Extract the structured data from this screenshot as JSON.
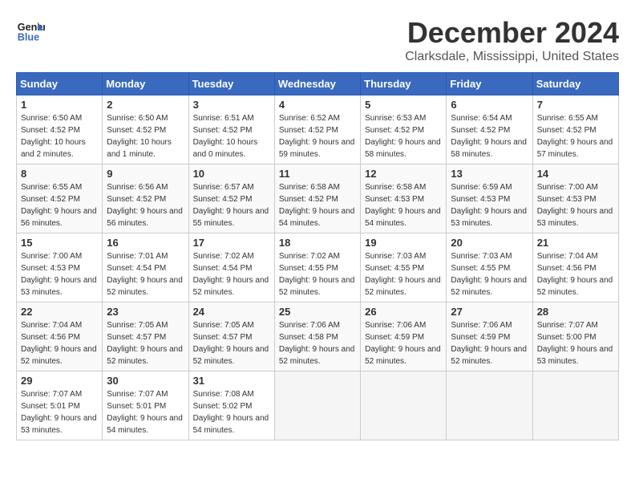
{
  "header": {
    "logo_line1": "General",
    "logo_line2": "Blue",
    "month_year": "December 2024",
    "location": "Clarksdale, Mississippi, United States"
  },
  "weekdays": [
    "Sunday",
    "Monday",
    "Tuesday",
    "Wednesday",
    "Thursday",
    "Friday",
    "Saturday"
  ],
  "weeks": [
    [
      {
        "day": "1",
        "sunrise": "6:50 AM",
        "sunset": "4:52 PM",
        "daylight": "10 hours and 2 minutes."
      },
      {
        "day": "2",
        "sunrise": "6:50 AM",
        "sunset": "4:52 PM",
        "daylight": "10 hours and 1 minute."
      },
      {
        "day": "3",
        "sunrise": "6:51 AM",
        "sunset": "4:52 PM",
        "daylight": "10 hours and 0 minutes."
      },
      {
        "day": "4",
        "sunrise": "6:52 AM",
        "sunset": "4:52 PM",
        "daylight": "9 hours and 59 minutes."
      },
      {
        "day": "5",
        "sunrise": "6:53 AM",
        "sunset": "4:52 PM",
        "daylight": "9 hours and 58 minutes."
      },
      {
        "day": "6",
        "sunrise": "6:54 AM",
        "sunset": "4:52 PM",
        "daylight": "9 hours and 58 minutes."
      },
      {
        "day": "7",
        "sunrise": "6:55 AM",
        "sunset": "4:52 PM",
        "daylight": "9 hours and 57 minutes."
      }
    ],
    [
      {
        "day": "8",
        "sunrise": "6:55 AM",
        "sunset": "4:52 PM",
        "daylight": "9 hours and 56 minutes."
      },
      {
        "day": "9",
        "sunrise": "6:56 AM",
        "sunset": "4:52 PM",
        "daylight": "9 hours and 56 minutes."
      },
      {
        "day": "10",
        "sunrise": "6:57 AM",
        "sunset": "4:52 PM",
        "daylight": "9 hours and 55 minutes."
      },
      {
        "day": "11",
        "sunrise": "6:58 AM",
        "sunset": "4:52 PM",
        "daylight": "9 hours and 54 minutes."
      },
      {
        "day": "12",
        "sunrise": "6:58 AM",
        "sunset": "4:53 PM",
        "daylight": "9 hours and 54 minutes."
      },
      {
        "day": "13",
        "sunrise": "6:59 AM",
        "sunset": "4:53 PM",
        "daylight": "9 hours and 53 minutes."
      },
      {
        "day": "14",
        "sunrise": "7:00 AM",
        "sunset": "4:53 PM",
        "daylight": "9 hours and 53 minutes."
      }
    ],
    [
      {
        "day": "15",
        "sunrise": "7:00 AM",
        "sunset": "4:53 PM",
        "daylight": "9 hours and 53 minutes."
      },
      {
        "day": "16",
        "sunrise": "7:01 AM",
        "sunset": "4:54 PM",
        "daylight": "9 hours and 52 minutes."
      },
      {
        "day": "17",
        "sunrise": "7:02 AM",
        "sunset": "4:54 PM",
        "daylight": "9 hours and 52 minutes."
      },
      {
        "day": "18",
        "sunrise": "7:02 AM",
        "sunset": "4:55 PM",
        "daylight": "9 hours and 52 minutes."
      },
      {
        "day": "19",
        "sunrise": "7:03 AM",
        "sunset": "4:55 PM",
        "daylight": "9 hours and 52 minutes."
      },
      {
        "day": "20",
        "sunrise": "7:03 AM",
        "sunset": "4:55 PM",
        "daylight": "9 hours and 52 minutes."
      },
      {
        "day": "21",
        "sunrise": "7:04 AM",
        "sunset": "4:56 PM",
        "daylight": "9 hours and 52 minutes."
      }
    ],
    [
      {
        "day": "22",
        "sunrise": "7:04 AM",
        "sunset": "4:56 PM",
        "daylight": "9 hours and 52 minutes."
      },
      {
        "day": "23",
        "sunrise": "7:05 AM",
        "sunset": "4:57 PM",
        "daylight": "9 hours and 52 minutes."
      },
      {
        "day": "24",
        "sunrise": "7:05 AM",
        "sunset": "4:57 PM",
        "daylight": "9 hours and 52 minutes."
      },
      {
        "day": "25",
        "sunrise": "7:06 AM",
        "sunset": "4:58 PM",
        "daylight": "9 hours and 52 minutes."
      },
      {
        "day": "26",
        "sunrise": "7:06 AM",
        "sunset": "4:59 PM",
        "daylight": "9 hours and 52 minutes."
      },
      {
        "day": "27",
        "sunrise": "7:06 AM",
        "sunset": "4:59 PM",
        "daylight": "9 hours and 52 minutes."
      },
      {
        "day": "28",
        "sunrise": "7:07 AM",
        "sunset": "5:00 PM",
        "daylight": "9 hours and 53 minutes."
      }
    ],
    [
      {
        "day": "29",
        "sunrise": "7:07 AM",
        "sunset": "5:01 PM",
        "daylight": "9 hours and 53 minutes."
      },
      {
        "day": "30",
        "sunrise": "7:07 AM",
        "sunset": "5:01 PM",
        "daylight": "9 hours and 54 minutes."
      },
      {
        "day": "31",
        "sunrise": "7:08 AM",
        "sunset": "5:02 PM",
        "daylight": "9 hours and 54 minutes."
      },
      null,
      null,
      null,
      null
    ]
  ]
}
